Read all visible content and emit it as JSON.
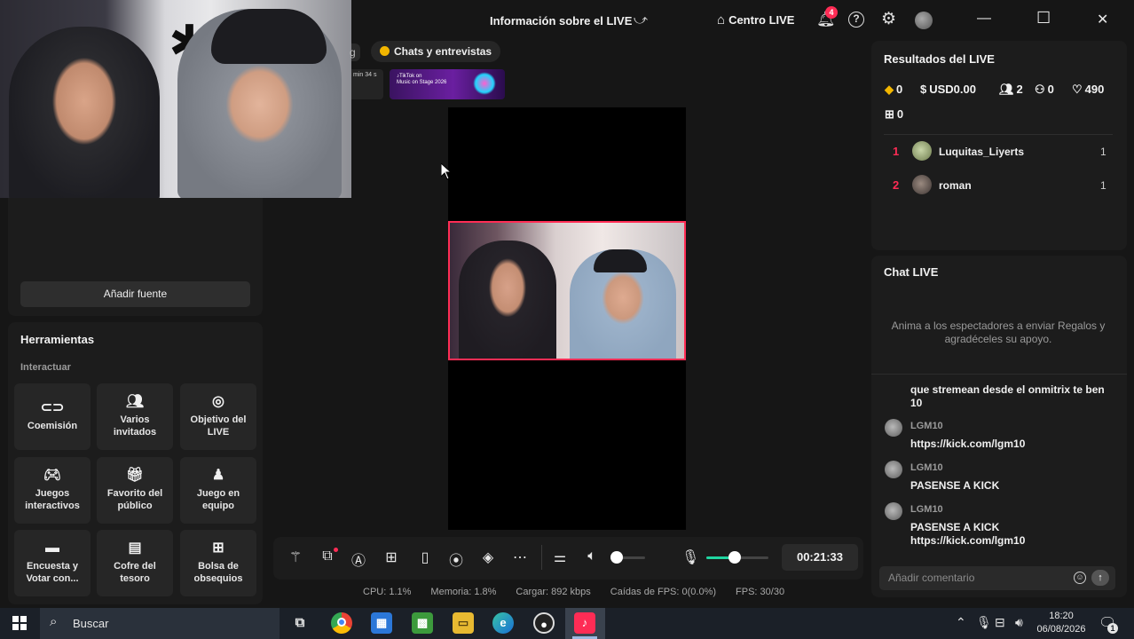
{
  "topbar": {
    "title": "Información sobre el LIVE",
    "centro_label": "Centro LIVE",
    "notification_count": "4",
    "help_symbol": "?",
    "window": {
      "minimize": "—",
      "maximize": "☐",
      "close": "✕"
    }
  },
  "tabs": {
    "partial_label": "g",
    "chats_label": "Chats y entrevistas"
  },
  "banners": {
    "partial_text": "min 34 s",
    "event_line1": "♪TikTok on",
    "event_line2": "Music on Stage 2026"
  },
  "left_panel": {
    "add_source_label": "Añadir fuente",
    "tools_title": "Herramientas",
    "tools_subtitle": "Interactuar",
    "tools": [
      {
        "label_1": "Coemisión",
        "label_2": "",
        "icon": "link-icon"
      },
      {
        "label_1": "Varios",
        "label_2": "invitados",
        "icon": "users-icon"
      },
      {
        "label_1": "Objetivo del",
        "label_2": "LIVE",
        "icon": "target-icon"
      },
      {
        "label_1": "Juegos",
        "label_2": "interactivos",
        "icon": "gamepad-icon"
      },
      {
        "label_1": "Favorito del",
        "label_2": "público",
        "icon": "gift-icon"
      },
      {
        "label_1": "Juego en",
        "label_2": "equipo",
        "icon": "team-icon"
      },
      {
        "label_1": "Encuesta y",
        "label_2": "Votar con...",
        "icon": "poll-icon"
      },
      {
        "label_1": "Cofre del",
        "label_2": "tesoro",
        "icon": "chest-icon"
      },
      {
        "label_1": "Bolsa de",
        "label_2": "obsequios",
        "icon": "bag-icon"
      }
    ]
  },
  "controls": {
    "timer": "00:21:33",
    "volume_level": 0.0,
    "mic_level": 0.45,
    "accent_green": "#20d5a0"
  },
  "stats": {
    "cpu": "CPU:  1.1%",
    "memory": "Memoria:  1.8%",
    "upload": "Cargar:  892 kbps",
    "dropped": "Caídas de FPS:  0(0.0%)",
    "fps": "FPS:  30/30"
  },
  "results": {
    "title": "Resultados del LIVE",
    "diamonds": "0",
    "usd": "USD0.00",
    "viewers": "2",
    "new_followers": "0",
    "likes": "490",
    "gifts": "0",
    "ranking": [
      {
        "rank": "1",
        "name": "Luquitas_Liyerts",
        "value": "1"
      },
      {
        "rank": "2",
        "name": "roman",
        "value": "1"
      }
    ]
  },
  "chat": {
    "title": "Chat LIVE",
    "hint": "Anima a los espectadores a enviar Regalos y agradéceles su apoyo.",
    "first_message": "que stremean desde el onmitrix te ben 10",
    "messages": [
      {
        "user": "LGM10",
        "text": "https://kick.com/lgm10"
      },
      {
        "user": "LGM10",
        "text": "PASENSE A KICK"
      },
      {
        "user": "LGM10",
        "text": "PASENSE A KICK https://kick.com/lgm10"
      }
    ],
    "comment_placeholder": "Añadir comentario"
  },
  "taskbar": {
    "search_label": "Buscar",
    "time": "18:20",
    "date": "06/08/2026",
    "notifications": "1"
  },
  "colors": {
    "accent_pink": "#fe2c55",
    "background": "#161616",
    "panel": "#1c1c1c"
  }
}
